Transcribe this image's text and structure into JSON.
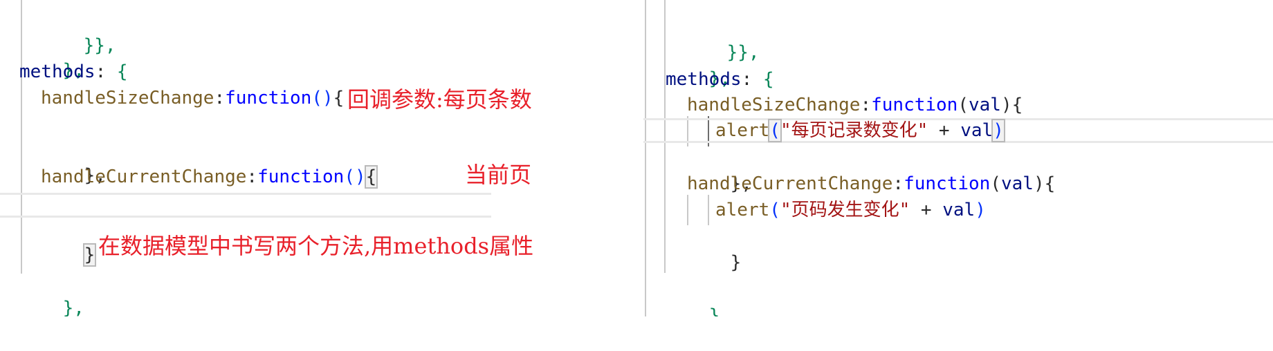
{
  "left_pane": {
    "lines": {
      "l0": "}},",
      "l1": "},",
      "l2_key": "methods",
      "l2_colon": ": ",
      "l2_brace": "{",
      "l3_prop": "handleSizeChange",
      "l3_colon": ":",
      "l3_kw": "function",
      "l3_parens": "()",
      "l3_brace": "{",
      "l5_close": "},",
      "l6_prop": "handleCurrentChange",
      "l6_colon": ":",
      "l6_kw": "function",
      "l6_parens": "()",
      "l6_brace": "{",
      "l8_close": "}",
      "l9": "},",
      "l10": "};"
    },
    "annotations": {
      "size_change_note": "回调参数:每页条数",
      "current_change_note": "当前页",
      "methods_note": "在数据模型中书写两个方法,用methods属性"
    }
  },
  "right_pane": {
    "lines": {
      "r0": "}},",
      "r1": "},",
      "r2_key": "methods",
      "r2_colon": ": ",
      "r2_brace": "{",
      "r3_prop": "handleSizeChange",
      "r3_colon": ":",
      "r3_kw": "function",
      "r3_open": "(",
      "r3_param": "val",
      "r3_close": "){",
      "r4_fn": "alert",
      "r4_open": "(",
      "r4_str": "\"每页记录数变化\"",
      "r4_op": " + ",
      "r4_param": "val",
      "r4_close": ")",
      "r5_close": "},",
      "r6_prop": "handleCurrentChange",
      "r6_colon": ":",
      "r6_kw": "function",
      "r6_open": "(",
      "r6_param": "val",
      "r6_close": "){",
      "r7_fn": "alert",
      "r7_open": "(",
      "r7_str": "\"页码发生变化\"",
      "r7_op": " + ",
      "r7_param": "val",
      "r7_close": ")",
      "r8_close": "}",
      "r10": "},",
      "r11": "};"
    }
  },
  "colors": {
    "property": "#795e26",
    "keyword": "#0000ff",
    "key": "#001080",
    "string": "#a31515",
    "annotation": "#e8202a"
  }
}
